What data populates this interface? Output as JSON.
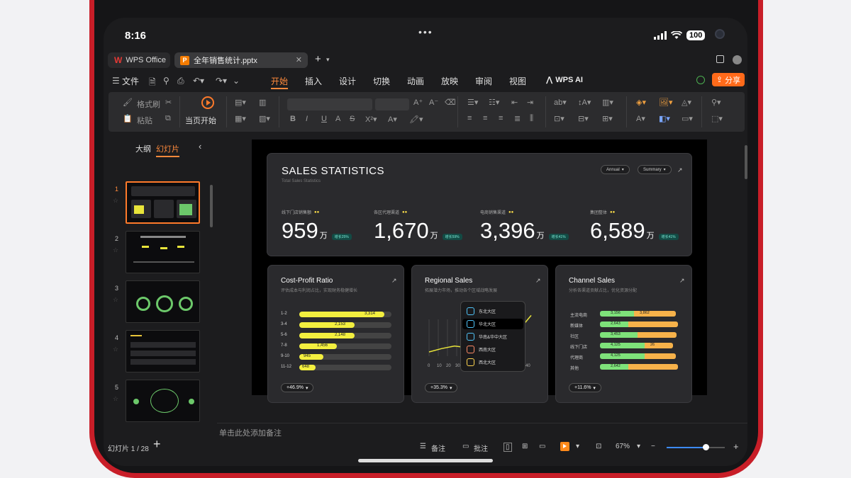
{
  "status": {
    "time": "8:16",
    "battery": "100"
  },
  "tabs": {
    "app_label": "WPS Office",
    "doc_label": "全年销售统计.pptx"
  },
  "menu": {
    "file_label": "文件",
    "items": [
      "开始",
      "插入",
      "设计",
      "切换",
      "动画",
      "放映",
      "审阅",
      "视图"
    ],
    "ai_label": "WPS AI",
    "share_label": "分享"
  },
  "ribbon": {
    "format_painter": "格式刷",
    "paste": "粘贴",
    "play_from_current": "当页开始"
  },
  "left_panel": {
    "tab_outline": "大纲",
    "tab_slides": "幻灯片",
    "slide_numbers": [
      "1",
      "2",
      "3",
      "4",
      "5"
    ]
  },
  "slide": {
    "title": "SALES STATISTICS",
    "subtitle": "Total Sales Statistics",
    "filter_period": "Annual",
    "filter_view": "Summary",
    "kpis": [
      {
        "label": "线下门店销售额",
        "value": "959",
        "unit": "万",
        "badge": "增长25%"
      },
      {
        "label": "各区代理渠道",
        "value": "1,670",
        "unit": "万",
        "badge": "增长59%"
      },
      {
        "label": "电商销售渠道",
        "value": "3,396",
        "unit": "万",
        "badge": "增长41%"
      },
      {
        "label": "集团整体",
        "value": "6,589",
        "unit": "万",
        "badge": "增长41%"
      }
    ],
    "cost_profit": {
      "title": "Cost-Profit Ratio",
      "subtitle": "评估成本与利润占比，实现财务稳健增长",
      "footer": "+46.9%",
      "chart_data": {
        "type": "bar",
        "categories": [
          "1-2",
          "3-4",
          "5-6",
          "7-8",
          "9-10",
          "11-12"
        ],
        "values": [
          3314,
          2153,
          2148,
          1456,
          945,
          648
        ],
        "value_labels": [
          "3,314",
          "2,153",
          "2,148",
          "1,456",
          "945",
          "648"
        ],
        "max": 3600
      }
    },
    "regional": {
      "title": "Regional Sales",
      "subtitle": "拓展潜力市场，推动各个区域战略发展",
      "footer": "+35.3%",
      "regions": [
        "东北大区",
        "华北大区",
        "华南&华中大区",
        "西南大区",
        "西北大区"
      ],
      "active_region": 1,
      "axis_labels": [
        "0",
        "10",
        "20",
        "30",
        "40"
      ],
      "chart_data": {
        "type": "line",
        "x": [
          0,
          5,
          10,
          15,
          20,
          25,
          30,
          35,
          40
        ],
        "values": [
          5,
          9,
          12,
          10,
          16,
          18,
          22,
          30,
          48
        ]
      }
    },
    "channel": {
      "title": "Channel Sales",
      "subtitle": "分析各渠道贡献占比，优化资源分配",
      "footer": "+11.6%",
      "chart_data": {
        "type": "bar",
        "stacked": true,
        "categories": [
          "主流电商",
          "新媒体",
          "社区",
          "线下门店",
          "代理商",
          "其他"
        ],
        "series": [
          {
            "values": [
              3.156,
              2.643,
              3.453,
              4.125,
              4.125,
              2.642
            ],
            "labels": [
              "3,156",
              "2,643",
              "3,453",
              "4,125",
              "4,125",
              "2,642"
            ]
          },
          {
            "values": [
              3.862,
              4.6,
              3.6,
              2.6,
              2.9,
              4.6
            ],
            "labels": [
              "3,862",
              "",
              "",
              "26",
              "",
              ""
            ]
          }
        ]
      }
    }
  },
  "notes_placeholder": "单击此处添加备注",
  "bottom": {
    "slide_counter": "幻灯片 1 / 28",
    "notes_btn": "备注",
    "comments_btn": "批注",
    "zoom": "67%",
    "zoom_level": 0.67
  }
}
